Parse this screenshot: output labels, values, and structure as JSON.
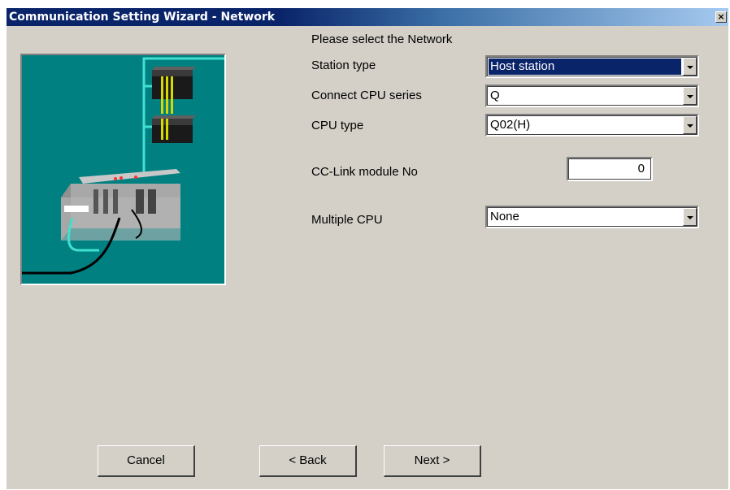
{
  "window": {
    "title": "Communication Setting Wizard - Network",
    "close_glyph": "×"
  },
  "form": {
    "prompt": "Please select the Network",
    "station_type": {
      "label": "Station type",
      "value": "Host station"
    },
    "connect_cpu_series": {
      "label": "Connect CPU series",
      "value": "Q"
    },
    "cpu_type": {
      "label": "CPU type",
      "value": "Q02(H)"
    },
    "cc_link_module_no": {
      "label": "CC-Link module No",
      "value": "0"
    },
    "multiple_cpu": {
      "label": "Multiple CPU",
      "value": "None"
    }
  },
  "buttons": {
    "cancel": "Cancel",
    "back": "< Back",
    "next": "Next >"
  },
  "colors": {
    "dialog_bg": "#d4d0c8",
    "title_bar": "#0a246a",
    "illustration_bg": "#008080",
    "selection": "#0a246a"
  },
  "icons": [
    "close-icon",
    "dropdown-arrow-icon",
    "network-illustration"
  ]
}
